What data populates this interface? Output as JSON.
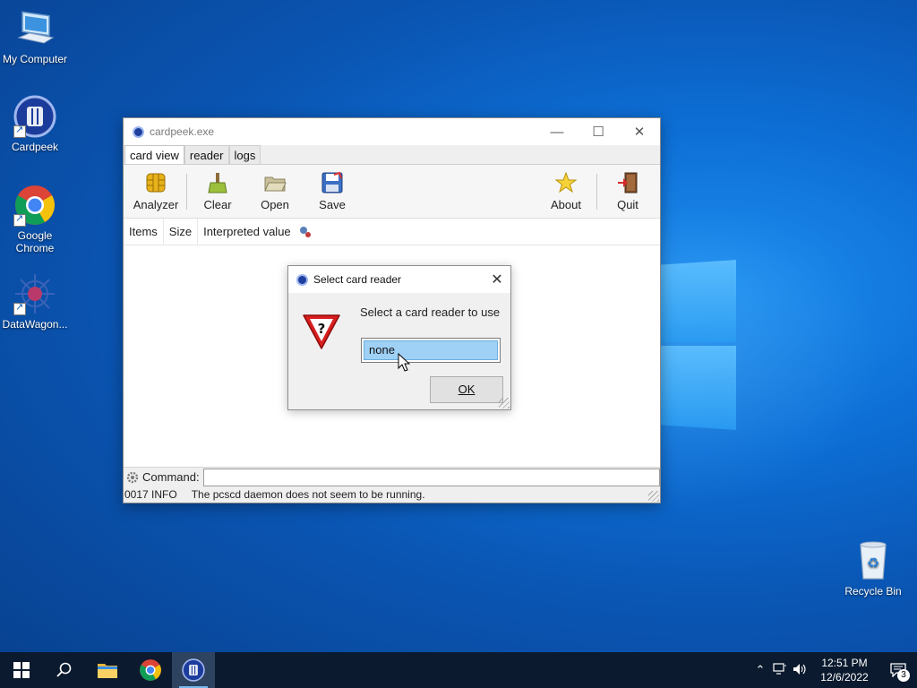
{
  "desktop": {
    "icons": [
      {
        "label": "My Computer",
        "icon": "computer-icon"
      },
      {
        "label": "Cardpeek",
        "icon": "cardpeek-icon"
      },
      {
        "label": "Google Chrome",
        "icon": "chrome-icon"
      },
      {
        "label": "DataWagon...",
        "icon": "datawagon-icon"
      },
      {
        "label": "Recycle Bin",
        "icon": "recycle-bin-icon"
      }
    ]
  },
  "window": {
    "title": "cardpeek.exe",
    "tabs": [
      "card view",
      "reader",
      "logs"
    ],
    "toolbar": {
      "analyzer": "Analyzer",
      "clear": "Clear",
      "open": "Open",
      "save": "Save",
      "about": "About",
      "quit": "Quit"
    },
    "columns": [
      "Items",
      "Size",
      "Interpreted value"
    ],
    "command_label": "Command:",
    "command_value": "",
    "status": {
      "code": "0017 INFO",
      "message": "The pcscd daemon does not seem to be running."
    }
  },
  "dialog": {
    "title": "Select card reader",
    "prompt": "Select a card reader to use",
    "selected_option": "none",
    "ok_label": "OK"
  },
  "taskbar": {
    "time": "12:51 PM",
    "date": "12/6/2022",
    "notification_count": "3"
  },
  "colors": {
    "desktop_bg": "#0a56b4",
    "taskbar_bg": "#0b1a2e",
    "selection": "#9fd0f5"
  }
}
